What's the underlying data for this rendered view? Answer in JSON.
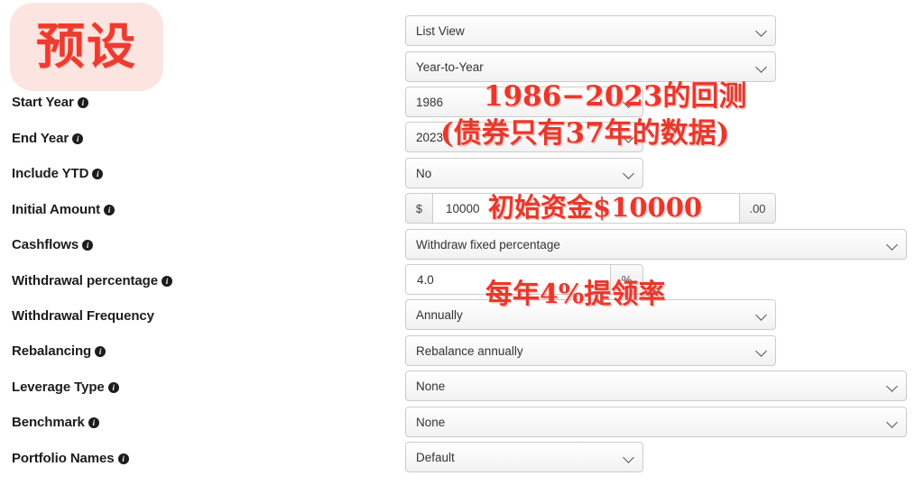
{
  "preset_badge": {
    "text": "预设"
  },
  "labels": [
    {
      "text": "Start Year",
      "info": true
    },
    {
      "text": "End Year",
      "info": true
    },
    {
      "text": "Include YTD",
      "info": true
    },
    {
      "text": "Initial Amount",
      "info": true
    },
    {
      "text": "Cashflows",
      "info": true
    },
    {
      "text": "Withdrawal percentage",
      "info": true
    },
    {
      "text": "Withdrawal Frequency",
      "info": false
    },
    {
      "text": "Rebalancing",
      "info": true
    },
    {
      "text": "Leverage Type",
      "info": true
    },
    {
      "text": "Benchmark",
      "info": true
    },
    {
      "text": "Portfolio Names",
      "info": true
    }
  ],
  "info_icon_glyph": "i",
  "controls": {
    "view_mode": {
      "value": "List View"
    },
    "comparison_period": {
      "value": "Year-to-Year"
    },
    "start_year": {
      "value": "1986"
    },
    "end_year": {
      "value": "2023"
    },
    "include_ytd": {
      "value": "No"
    },
    "initial_amount": {
      "prefix": "$",
      "value": "10000",
      "suffix": ".00"
    },
    "cashflows": {
      "value": "Withdraw fixed percentage"
    },
    "withdrawal_percentage": {
      "value": "4.0",
      "suffix": "%"
    },
    "withdrawal_frequency": {
      "value": "Annually"
    },
    "rebalancing": {
      "value": "Rebalance annually"
    },
    "leverage_type": {
      "value": "None"
    },
    "benchmark": {
      "value": "None"
    },
    "portfolio_names": {
      "value": "Default"
    }
  },
  "annotations": {
    "date_range": "1986−2023的回测",
    "bond_note": "(债券只有37年的数据)",
    "initial_cash": "初始资金$10000",
    "withdraw_rate": "每年4%提领率"
  },
  "colors": {
    "annotation_red": "#e8382c",
    "badge_bg": "#fce4e0",
    "badge_text": "#ee3b2f"
  }
}
